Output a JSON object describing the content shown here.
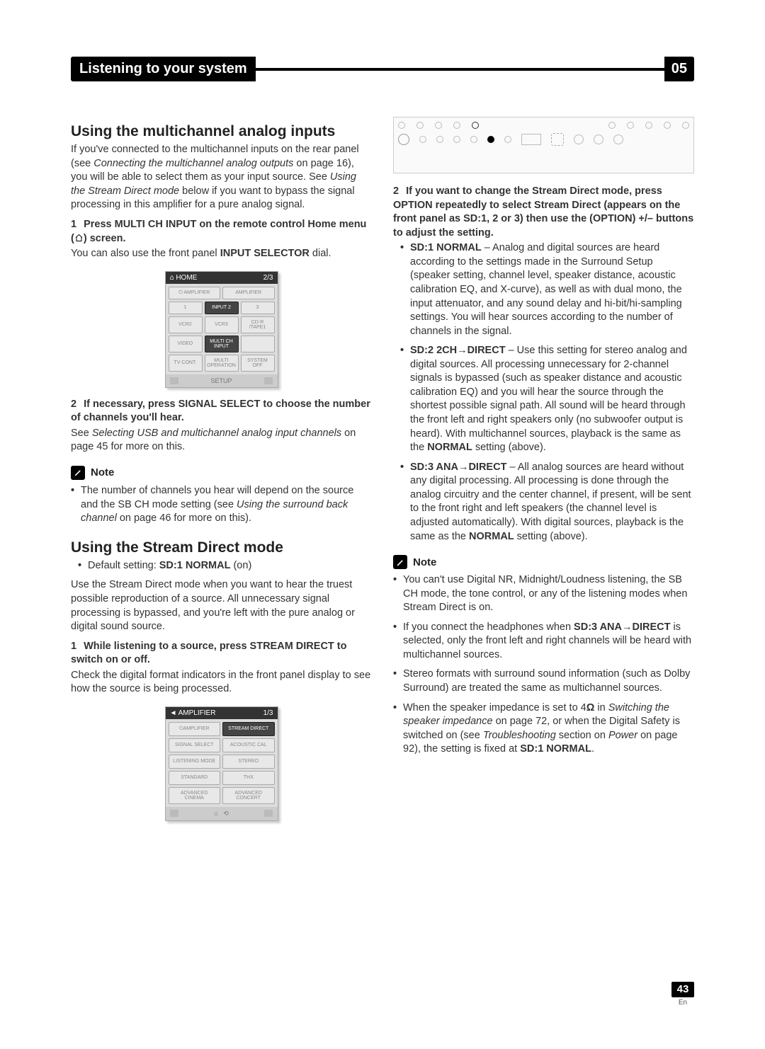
{
  "header": {
    "title": "Listening to your system",
    "chapter": "05"
  },
  "left": {
    "h_multi": "Using the multichannel analog inputs",
    "p_multi_intro_a": "If you've connected to the multichannel inputs on the rear panel (see ",
    "p_multi_intro_b": "Connecting the multichannel analog outputs",
    "p_multi_intro_c": " on page 16), you will be able to select them as your input source. See ",
    "p_multi_intro_d": "Using the Stream Direct mode",
    "p_multi_intro_e": " below if you want to bypass the signal processing in this amplifier for a pure analog signal.",
    "step1_a": "1",
    "step1_b": "Press MULTI CH INPUT on the remote control Home menu (",
    "step1_c": ") screen.",
    "step1_sub_a": "You can also use the front panel ",
    "step1_sub_b": "INPUT SELECTOR",
    "step1_sub_c": " dial.",
    "fig1": {
      "top_l": "HOME",
      "top_r": "2/3",
      "cells": [
        {
          "t": "⏻ AMPLIFIER"
        },
        {
          "t": "AMPLIFIER"
        },
        {
          "t": "1"
        },
        {
          "t": "INPUT 2",
          "sel": true
        },
        {
          "t": "3"
        },
        {
          "t": "VCR2"
        },
        {
          "t": "VCR3"
        },
        {
          "t": "CD-R /TAPE1"
        },
        {
          "t": "VIDEO"
        },
        {
          "t": "MULTI CH INPUT",
          "sel": true
        },
        {
          "t": ""
        },
        {
          "t": "TV CONT."
        },
        {
          "t": "MULTI OPERATION"
        },
        {
          "t": "SYSTEM OFF"
        }
      ],
      "btm": "SETUP"
    },
    "step2_a": "2",
    "step2_b": "If necessary, press SIGNAL SELECT to choose the number of channels you'll hear.",
    "step2_sub_a": "See ",
    "step2_sub_b": "Selecting USB and multichannel analog input channels",
    "step2_sub_c": " on page 45 for more on this.",
    "note_label": "Note",
    "note1_a": "The number of channels you hear will depend on the source and the SB CH mode setting (see ",
    "note1_b": "Using the surround back channel",
    "note1_c": " on page 46 for more on this).",
    "h_sd": "Using the Stream Direct mode",
    "sd_def_a": "Default setting: ",
    "sd_def_b": "SD:1 NORMAL",
    "sd_def_c": " (on)",
    "sd_intro": "Use the Stream Direct mode when you want to hear the truest possible reproduction of a source. All unnecessary signal processing is bypassed, and you're left with the pure analog or digital sound source.",
    "sd_step1_a": "1",
    "sd_step1_b": "While listening to a source, press STREAM DIRECT to switch on or off.",
    "sd_step1_sub": "Check the digital format indicators in the front panel display to see how the source is being processed.",
    "fig2": {
      "top_l": "AMPLIFIER",
      "top_r": "1/3",
      "cells": [
        {
          "t": "⏻AMPLIFIER"
        },
        {
          "t": "STREAM DIRECT",
          "sel": true
        },
        {
          "t": "SIGNAL SELECT"
        },
        {
          "t": "ACOUSTIC CAL"
        },
        {
          "t": "LISTENING MODE"
        },
        {
          "t": "STEREO"
        },
        {
          "t": "STANDARD"
        },
        {
          "t": "THX"
        },
        {
          "t": "ADVANCED CINEMA"
        },
        {
          "t": "ADVANCED CONCERT"
        }
      ]
    }
  },
  "right": {
    "step2_a": "2",
    "step2_b": "If you want to change the Stream Direct mode, press OPTION repeatedly to select Stream Direct (appears on the front panel as SD:1, 2 or 3) then use the (OPTION) +/– buttons to adjust the setting.",
    "sd1_a": "SD:1 NORMAL",
    "sd1_b": " – Analog and digital sources are heard according to the settings made in the Surround Setup (speaker setting, channel level, speaker distance, acoustic calibration EQ, and X-curve), as well as with dual mono, the input attenuator, and any sound delay and hi-bit/hi-sampling settings. You will hear sources according to the number of channels in the signal.",
    "sd2_a": "SD:2 2CH",
    "sd2_arrow": "→",
    "sd2_a2": "DIRECT",
    "sd2_b": " – Use this setting for stereo analog and digital sources. All processing unnecessary for 2-channel signals is bypassed (such as speaker distance and acoustic calibration EQ) and you will hear the source through the shortest possible signal path. All sound will be heard through the front left and right speakers only (no subwoofer output is heard). With multichannel sources, playback is the same as the ",
    "sd2_c": "NORMAL",
    "sd2_d": " setting (above).",
    "sd3_a": "SD:3 ANA",
    "sd3_arrow": "→",
    "sd3_a2": "DIRECT",
    "sd3_b": " – All analog sources are heard without any digital processing. All processing is done through the analog circuitry and the center channel, if present, will be sent to the front right and left speakers (the channel level is adjusted automatically). With digital sources, playback is the same as the ",
    "sd3_c": "NORMAL",
    "sd3_d": " setting (above).",
    "rnote_label": "Note",
    "rn1": "You can't use Digital NR, Midnight/Loudness listening, the SB CH mode, the tone control, or any of the listening modes when Stream Direct is on.",
    "rn2_a": "If you connect the headphones when ",
    "rn2_b": "SD:3 ANA",
    "rn2_arrow": "→",
    "rn2_b2": "DIRECT",
    "rn2_c": " is selected, only the front left and right channels will be heard with multichannel sources.",
    "rn3": "Stereo formats with surround sound information (such as Dolby Surround) are treated the same as multichannel sources.",
    "rn4_a": "When the speaker impedance is set to 4",
    "rn4_ohm": "Ω",
    "rn4_b": " in ",
    "rn4_c": "Switching the speaker impedance",
    "rn4_d": " on page 72, or when the Digital Safety is switched on (see ",
    "rn4_e": "Troubleshooting",
    "rn4_f": " section on ",
    "rn4_g": "Power",
    "rn4_h": " on page 92), the setting is fixed at ",
    "rn4_i": "SD:1 NORMAL",
    "rn4_j": "."
  },
  "page": {
    "num": "43",
    "lang": "En"
  }
}
